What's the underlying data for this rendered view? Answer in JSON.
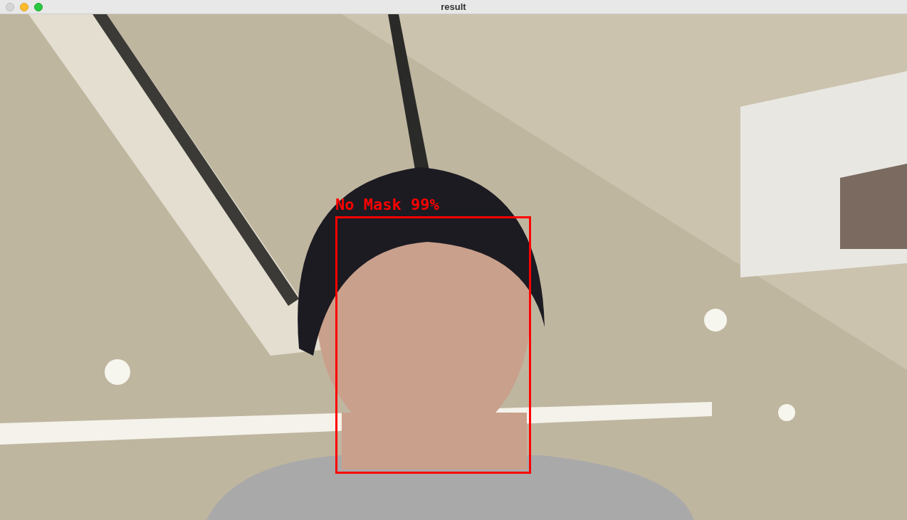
{
  "window": {
    "title": "result"
  },
  "detections": [
    {
      "label": "No Mask 99%"
    }
  ]
}
